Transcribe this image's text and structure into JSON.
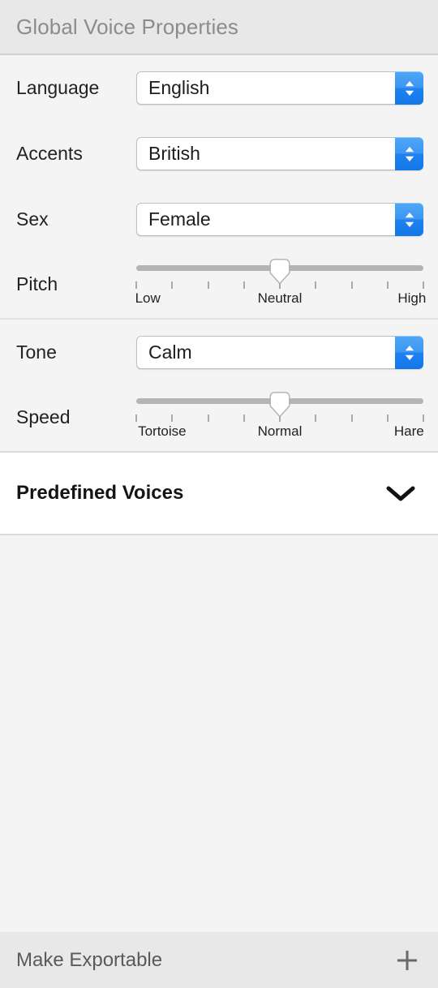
{
  "header": {
    "title": "Global Voice Properties"
  },
  "form": {
    "sections": [
      {
        "rows": [
          {
            "type": "select",
            "label": "Language",
            "value": "English",
            "icon": "updown-chevron-icon",
            "name": "language"
          },
          {
            "type": "select",
            "label": "Accents",
            "value": "British",
            "icon": "updown-chevron-icon",
            "name": "accents"
          },
          {
            "type": "select",
            "label": "Sex",
            "value": "Female",
            "icon": "updown-chevron-icon",
            "name": "sex"
          },
          {
            "type": "slider",
            "label": "Pitch",
            "name": "pitch",
            "min_label": "Low",
            "mid_label": "Neutral",
            "max_label": "High",
            "value_percent": 50,
            "tick_count": 9
          }
        ]
      },
      {
        "rows": [
          {
            "type": "select",
            "label": "Tone",
            "value": "Calm",
            "icon": "updown-chevron-icon",
            "name": "tone"
          },
          {
            "type": "slider",
            "label": "Speed",
            "name": "speed",
            "min_label": "Tortoise",
            "mid_label": "Normal",
            "max_label": "Hare",
            "value_percent": 50,
            "tick_count": 9
          }
        ]
      }
    ]
  },
  "disclosure": {
    "title": "Predefined Voices",
    "icon": "chevron-down-icon",
    "expanded": false
  },
  "bottom_bar": {
    "label": "Make Exportable",
    "icon": "plus-icon"
  },
  "colors": {
    "accent_blue": "#2a8cf0",
    "header_bg": "#e8e8e8",
    "body_bg": "#f4f4f4",
    "track_gray": "#b4b4b4",
    "title_gray": "#8c8c8c"
  }
}
